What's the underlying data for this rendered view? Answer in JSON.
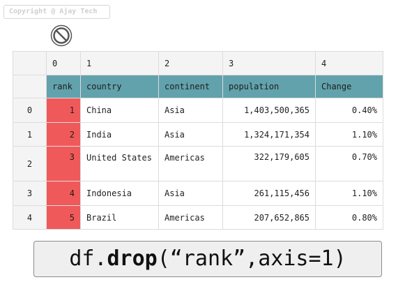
{
  "copyright": "Copyright @ Ajay Tech",
  "icon": "no-entry-icon",
  "column_index": [
    "0",
    "1",
    "2",
    "3",
    "4"
  ],
  "headers": [
    "rank",
    "country",
    "continent",
    "population",
    "Change"
  ],
  "rows": [
    {
      "index": "0",
      "rank": "1",
      "country": "China",
      "continent": "Asia",
      "population": "1,403,500,365",
      "change": "0.40%"
    },
    {
      "index": "1",
      "rank": "2",
      "country": "India",
      "continent": "Asia",
      "population": "1,324,171,354",
      "change": "1.10%"
    },
    {
      "index": "2",
      "rank": "3",
      "country": "United States",
      "continent": "Americas",
      "population": "322,179,605",
      "change": "0.70%"
    },
    {
      "index": "3",
      "rank": "4",
      "country": "Indonesia",
      "continent": "Asia",
      "population": "261,115,456",
      "change": "1.10%"
    },
    {
      "index": "4",
      "rank": "5",
      "country": "Brazil",
      "continent": "Americas",
      "population": "207,652,865",
      "change": "0.80%"
    }
  ],
  "code": {
    "obj": "df.",
    "method": "drop",
    "args": "(“rank”,axis=1)"
  },
  "colors": {
    "header_bg": "#62a2ac",
    "rank_bg": "#f0595a",
    "index_bg": "#f4f4f4"
  }
}
